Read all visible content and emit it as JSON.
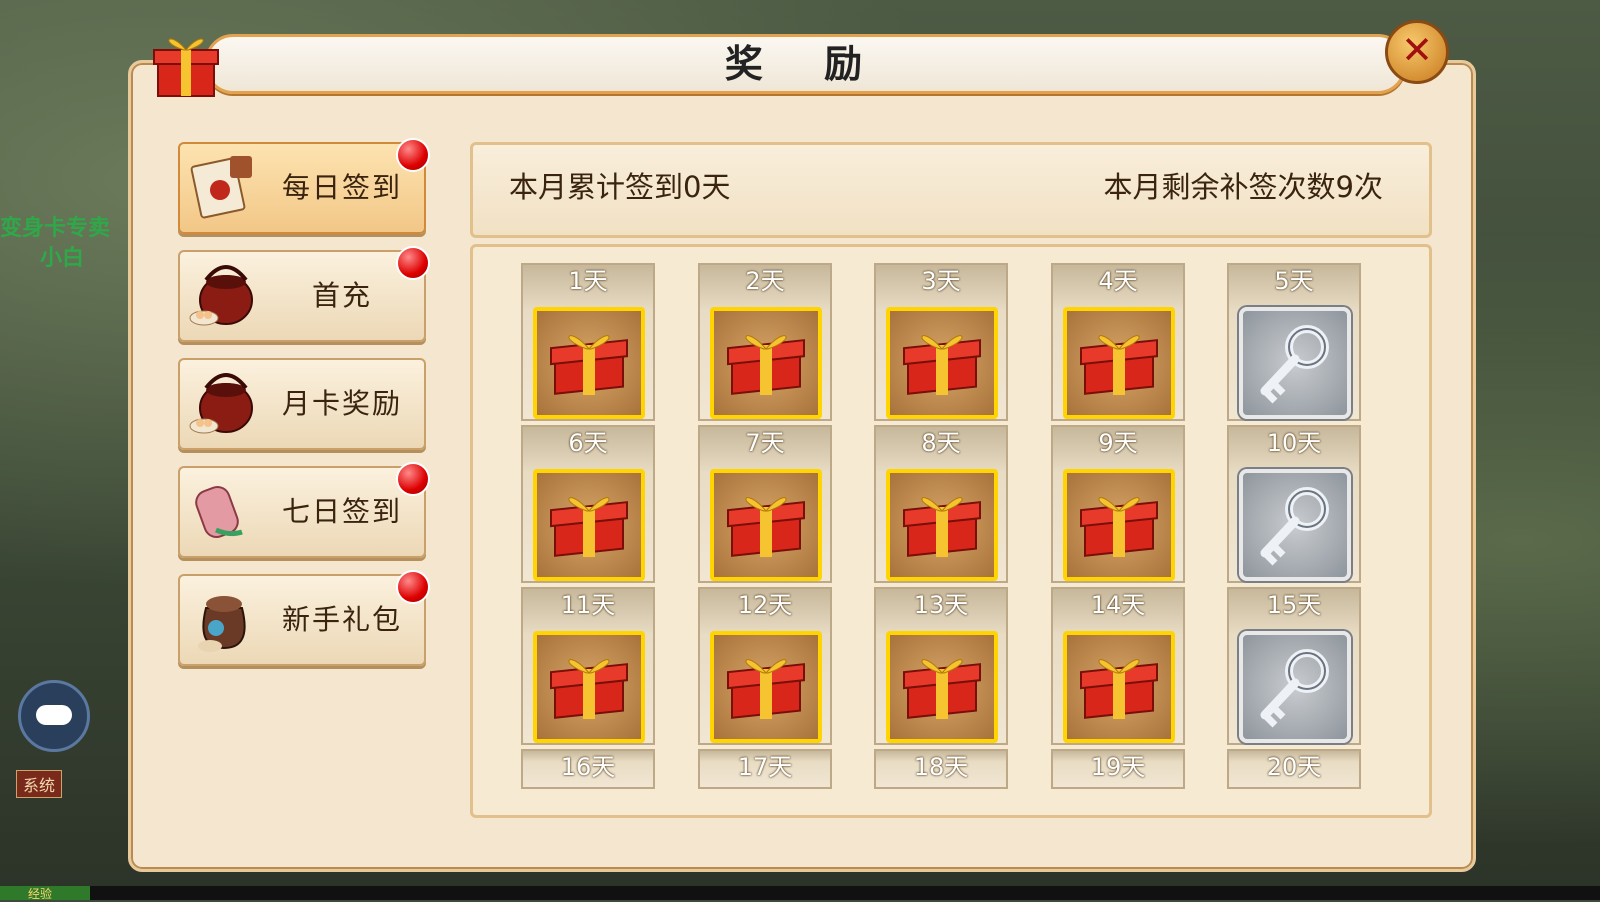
{
  "title": "奖 励",
  "close_label": "✕",
  "background": {
    "left_text_1": "变身卡专卖",
    "left_text_2": "小白",
    "sys_tag": "系统",
    "exp_label": "经验"
  },
  "menu": [
    {
      "label": "每日签到",
      "icon": "calendar-scroll-icon",
      "active": true,
      "dot": true
    },
    {
      "label": "首充",
      "icon": "food-basket-icon",
      "active": false,
      "dot": true
    },
    {
      "label": "月卡奖励",
      "icon": "food-basket-icon",
      "active": false,
      "dot": false
    },
    {
      "label": "七日签到",
      "icon": "scroll-icon",
      "active": false,
      "dot": true
    },
    {
      "label": "新手礼包",
      "icon": "treasure-bag-icon",
      "active": false,
      "dot": true
    }
  ],
  "info": {
    "left": "本月累计签到0天",
    "right": "本月剩余补签次数9次"
  },
  "days": [
    {
      "label": "1天",
      "reward": "gift"
    },
    {
      "label": "2天",
      "reward": "gift"
    },
    {
      "label": "3天",
      "reward": "gift"
    },
    {
      "label": "4天",
      "reward": "gift"
    },
    {
      "label": "5天",
      "reward": "key"
    },
    {
      "label": "6天",
      "reward": "gift"
    },
    {
      "label": "7天",
      "reward": "gift"
    },
    {
      "label": "8天",
      "reward": "gift"
    },
    {
      "label": "9天",
      "reward": "gift"
    },
    {
      "label": "10天",
      "reward": "key"
    },
    {
      "label": "11天",
      "reward": "gift"
    },
    {
      "label": "12天",
      "reward": "gift"
    },
    {
      "label": "13天",
      "reward": "gift"
    },
    {
      "label": "14天",
      "reward": "gift"
    },
    {
      "label": "15天",
      "reward": "key"
    },
    {
      "label": "16天",
      "reward": "partial"
    },
    {
      "label": "17天",
      "reward": "partial"
    },
    {
      "label": "18天",
      "reward": "partial"
    },
    {
      "label": "19天",
      "reward": "partial"
    },
    {
      "label": "20天",
      "reward": "partial"
    }
  ]
}
